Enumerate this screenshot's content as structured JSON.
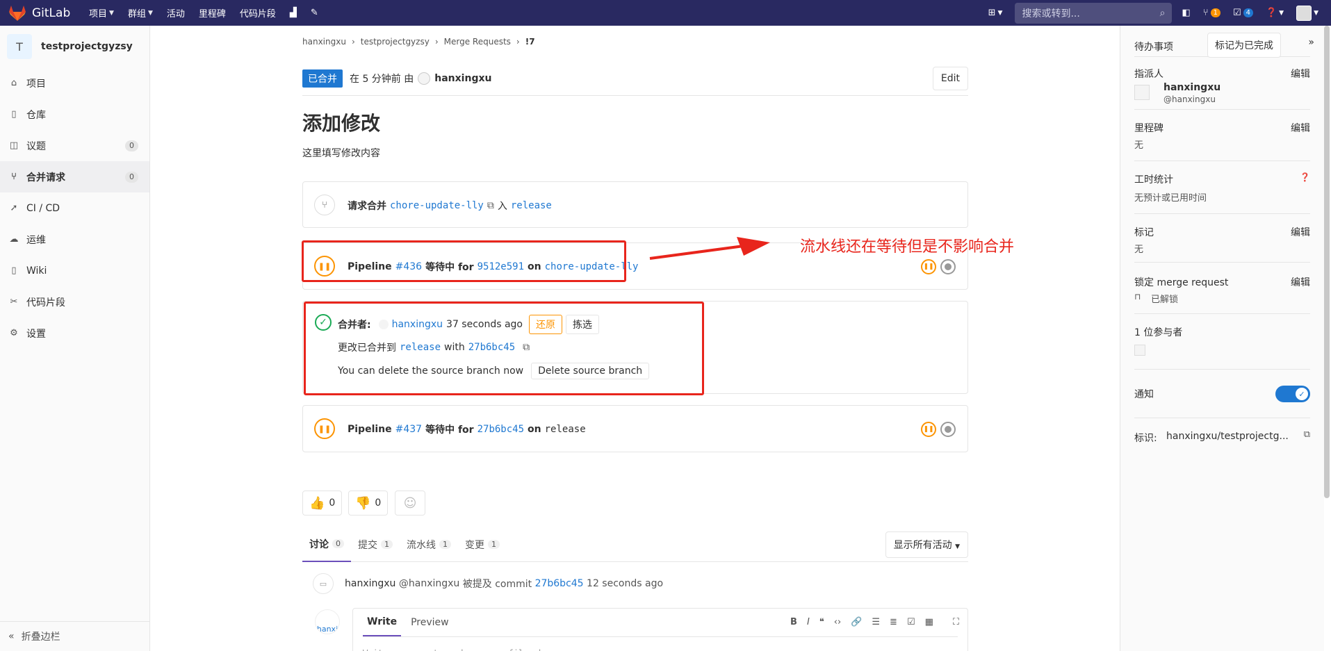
{
  "navbar": {
    "brand": "GitLab",
    "items": [
      "项目",
      "群组",
      "活动",
      "里程碑",
      "代码片段"
    ],
    "search_placeholder": "搜索或转到...",
    "mr_count": "1",
    "todo_count": "4"
  },
  "sidebar": {
    "project_initial": "T",
    "project_name": "testprojectgyzsy",
    "items": [
      {
        "label": "项目",
        "icon": "home-icon"
      },
      {
        "label": "仓库",
        "icon": "book-icon"
      },
      {
        "label": "议题",
        "icon": "issues-icon",
        "count": "0"
      },
      {
        "label": "合并请求",
        "icon": "merge-request-icon",
        "count": "0"
      },
      {
        "label": "CI / CD",
        "icon": "rocket-icon"
      },
      {
        "label": "运维",
        "icon": "cloud-gear-icon"
      },
      {
        "label": "Wiki",
        "icon": "book-icon"
      },
      {
        "label": "代码片段",
        "icon": "scissors-icon"
      },
      {
        "label": "设置",
        "icon": "gear-icon"
      }
    ],
    "collapse_label": "折叠边栏"
  },
  "breadcrumb": [
    "hanxingxu",
    "testprojectgyzsy",
    "Merge Requests",
    "!7"
  ],
  "header": {
    "status": "已合并",
    "time_text": "在 5 分钟前 由",
    "author": "hanxingxu",
    "edit_label": "Edit"
  },
  "mr": {
    "title": "添加修改",
    "description": "这里填写修改内容"
  },
  "widget": {
    "request_label": "请求合并",
    "source_branch": "chore-update-lly",
    "into_label": "入",
    "target_branch": "release",
    "pipeline1": {
      "label": "Pipeline",
      "id": "#436",
      "status": "等待中 for",
      "commit": "9512e591",
      "on": "on",
      "branch": "chore-update-lly"
    },
    "merged_by_label": "合并者:",
    "merged_by_user": "hanxingxu",
    "merged_ago": "37 seconds ago",
    "revert_label": "还原",
    "cherry_pick_label": "拣选",
    "merged_into_text": "更改已合并到",
    "merged_branch": "release",
    "with_label": "with",
    "merge_commit": "27b6bc45",
    "delete_hint": "You can delete the source branch now",
    "delete_button": "Delete source branch",
    "pipeline2": {
      "label": "Pipeline",
      "id": "#437",
      "status": "等待中 for",
      "commit": "27b6bc45",
      "on": "on",
      "branch": "release"
    }
  },
  "annotation": {
    "text": "流水线还在等待但是不影响合并",
    "color": "#e8251c"
  },
  "awards": {
    "thumbs_up": "0",
    "thumbs_down": "0"
  },
  "tabs": [
    {
      "label": "讨论",
      "count": "0"
    },
    {
      "label": "提交",
      "count": "1"
    },
    {
      "label": "流水线",
      "count": "1"
    },
    {
      "label": "变更",
      "count": "1"
    }
  ],
  "filter_label": "显示所有活动",
  "note": {
    "user": "hanxingxu",
    "handle": "@hanxingxu",
    "action": "被提及 commit",
    "commit": "27b6bc45",
    "time": "12 seconds ago"
  },
  "editor": {
    "avatar_alt": "hanxi",
    "write_tab": "Write",
    "preview_tab": "Preview",
    "placeholder": "Write a comment or drag your files here…"
  },
  "right_sidebar": {
    "todo_label": "待办事项",
    "mark_done": "标记为已完成",
    "assignee_label": "指派人",
    "edit": "编辑",
    "assignee_name": "hanxingxu",
    "assignee_handle": "@hanxingxu",
    "milestone_label": "里程碑",
    "milestone_value": "无",
    "time_label": "工时统计",
    "time_value": "无预计或已用时间",
    "labels_label": "标记",
    "labels_value": "无",
    "lock_label": "锁定 merge request",
    "lock_value": "已解锁",
    "participants_label": "1 位参与者",
    "notify_label": "通知",
    "ref_label": "标识:",
    "ref_value": "hanxingxu/testprojectg..."
  }
}
